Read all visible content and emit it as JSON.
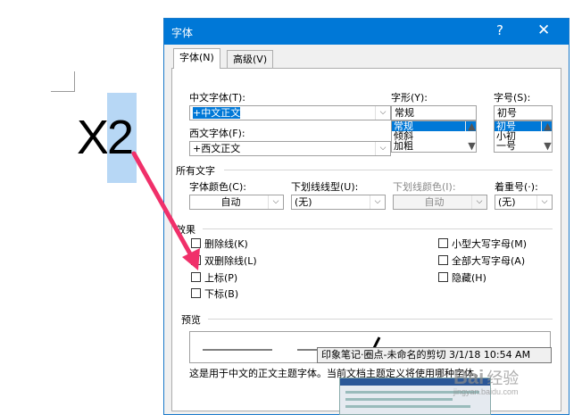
{
  "document": {
    "char_x": "X",
    "char_2": "2"
  },
  "dialog": {
    "title": "字体",
    "help": "?",
    "close": "✕",
    "tabs": [
      {
        "label": "字体(N)"
      },
      {
        "label": "高级(V)"
      }
    ],
    "cn_font": {
      "label": "中文字体(T):",
      "value": "+中文正文"
    },
    "west_font": {
      "label": "西文字体(F):",
      "value": "+西文正文"
    },
    "style": {
      "label": "字形(Y):",
      "value": "常规",
      "options": [
        "常规",
        "倾斜",
        "加粗"
      ]
    },
    "size": {
      "label": "字号(S):",
      "value": "初号",
      "options": [
        "初号",
        "小初",
        "一号"
      ]
    },
    "all_text": {
      "title": "所有文字",
      "color_label": "字体颜色(C):",
      "color_value": "自动",
      "underline_label": "下划线线型(U):",
      "underline_value": "(无)",
      "underline_color_label": "下划线颜色(I):",
      "underline_color_value": "自动",
      "emphasis_label": "着重号(·):",
      "emphasis_value": "(无)"
    },
    "effects": {
      "title": "效果",
      "left": [
        "删除线(K)",
        "双删除线(L)",
        "上标(P)",
        "下标(B)"
      ],
      "right": [
        "小型大写字母(M)",
        "全部大写字母(A)",
        "隐藏(H)"
      ]
    },
    "preview": {
      "title": "预览",
      "description": "这是用于中文的正文主题字体。当前文档主题定义将使用哪种字体。"
    }
  },
  "tooltip": "印象笔记·圈点-未命名的剪切 3/1/18 10:54 AM",
  "watermark": {
    "main": "Bai",
    "cn": "经验",
    "url": "jingyan.baidu.com"
  },
  "colors": {
    "title_bar": "#0078d7",
    "selection": "#0078d7",
    "highlight": "#b7d7f5",
    "arrow": "#f0306a"
  }
}
